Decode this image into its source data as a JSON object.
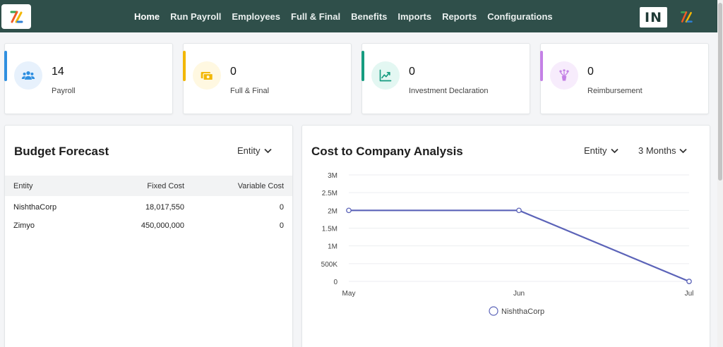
{
  "nav": {
    "items": [
      {
        "label": "Home",
        "active": true
      },
      {
        "label": "Run Payroll"
      },
      {
        "label": "Employees"
      },
      {
        "label": "Full & Final"
      },
      {
        "label": "Benefits"
      },
      {
        "label": "Imports"
      },
      {
        "label": "Reports"
      },
      {
        "label": "Configurations"
      }
    ],
    "avatar_initials": "IN"
  },
  "stats": [
    {
      "count": "14",
      "label": "Payroll",
      "icon": "people-icon",
      "accent": "#2f8fe0",
      "icon_bg": "#e7f1fc",
      "icon_color": "#2f8fe0"
    },
    {
      "count": "0",
      "label": "Full & Final",
      "icon": "money-icon",
      "accent": "#f2b705",
      "icon_bg": "#fff8e1",
      "icon_color": "#f2b705"
    },
    {
      "count": "0",
      "label": "Investment Declaration",
      "icon": "trending-up-icon",
      "accent": "#169c80",
      "icon_bg": "#e3f7f2",
      "icon_color": "#169c80"
    },
    {
      "count": "0",
      "label": "Reimbursement",
      "icon": "reimburse-icon",
      "accent": "#c481e6",
      "icon_bg": "#f7ecfc",
      "icon_color": "#c481e6"
    }
  ],
  "budget": {
    "title": "Budget Forecast",
    "filter": "Entity",
    "columns": [
      "Entity",
      "Fixed Cost",
      "Variable Cost"
    ],
    "rows": [
      [
        "NishthaCorp",
        "18,017,550",
        "0"
      ],
      [
        "Zimyo",
        "450,000,000",
        "0"
      ]
    ]
  },
  "ctc": {
    "title": "Cost to Company Analysis",
    "filter_entity": "Entity",
    "filter_period": "3 Months"
  },
  "chart_data": {
    "type": "line",
    "title": "Cost to Company Analysis",
    "categories": [
      "May",
      "Jun",
      "Jul"
    ],
    "y_ticks": [
      "0",
      "500K",
      "1M",
      "1.5M",
      "2M",
      "2.5M",
      "3M"
    ],
    "ylim": [
      0,
      3000000
    ],
    "grid": true,
    "legend_position": "bottom",
    "series": [
      {
        "name": "NishthaCorp",
        "values": [
          2000000,
          2000000,
          0
        ],
        "color": "#5b63b8"
      }
    ]
  }
}
